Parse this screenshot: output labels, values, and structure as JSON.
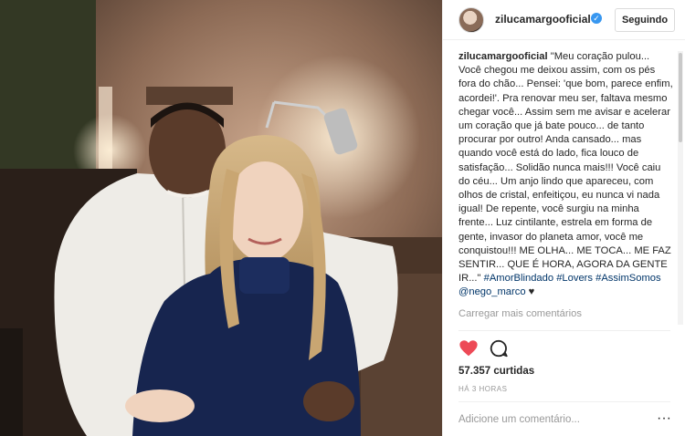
{
  "post": {
    "username": "zilucamargooficial",
    "follow_label": "Seguindo",
    "caption_author": "zilucamargooficial",
    "caption_text": " \"Meu coração pulou... Você chegou me deixou assim, com os pés fora do chão... Pensei: 'que bom, parece enfim, acordei!'. Pra renovar meu ser, faltava mesmo chegar você... Assim sem me avisar e acelerar um coração que já bate pouco... de tanto procurar por outro! Anda cansado... mas quando você está do lado, fica louco de satisfação... Solidão nunca mais!!! Você caiu do céu... Um anjo lindo que apareceu, com olhos de cristal, enfeitiçou, eu nunca vi nada igual! De repente, você surgiu na minha frente... Luz cintilante, estrela em forma de gente, invasor do planeta amor, você me conquistou!!! ME OLHA... ME TOCA... ME FAZ SENTIR... QUE É HORA, AGORA DA GENTE IR...\" ",
    "tag_amor": "#AmorBlindado",
    "tag_lovers": "#Lovers",
    "tag_assim": "#AssimSomos",
    "mention": "@nego_marco",
    "heart_emoji": "♥",
    "load_more": "Carregar mais comentários",
    "likes": "57.357 curtidas",
    "time": "HÁ 3 HORAS",
    "comment_placeholder": "Adicione um comentário...",
    "more_glyph": "···"
  },
  "icons": {
    "verified": "verified-badge-icon",
    "like": "heart-icon",
    "comment": "comment-bubble-icon",
    "more": "more-options-icon"
  },
  "colors": {
    "like": "#ed4956",
    "verified": "#3897f0",
    "link": "#003569",
    "muted": "#999999",
    "text": "#262626"
  }
}
